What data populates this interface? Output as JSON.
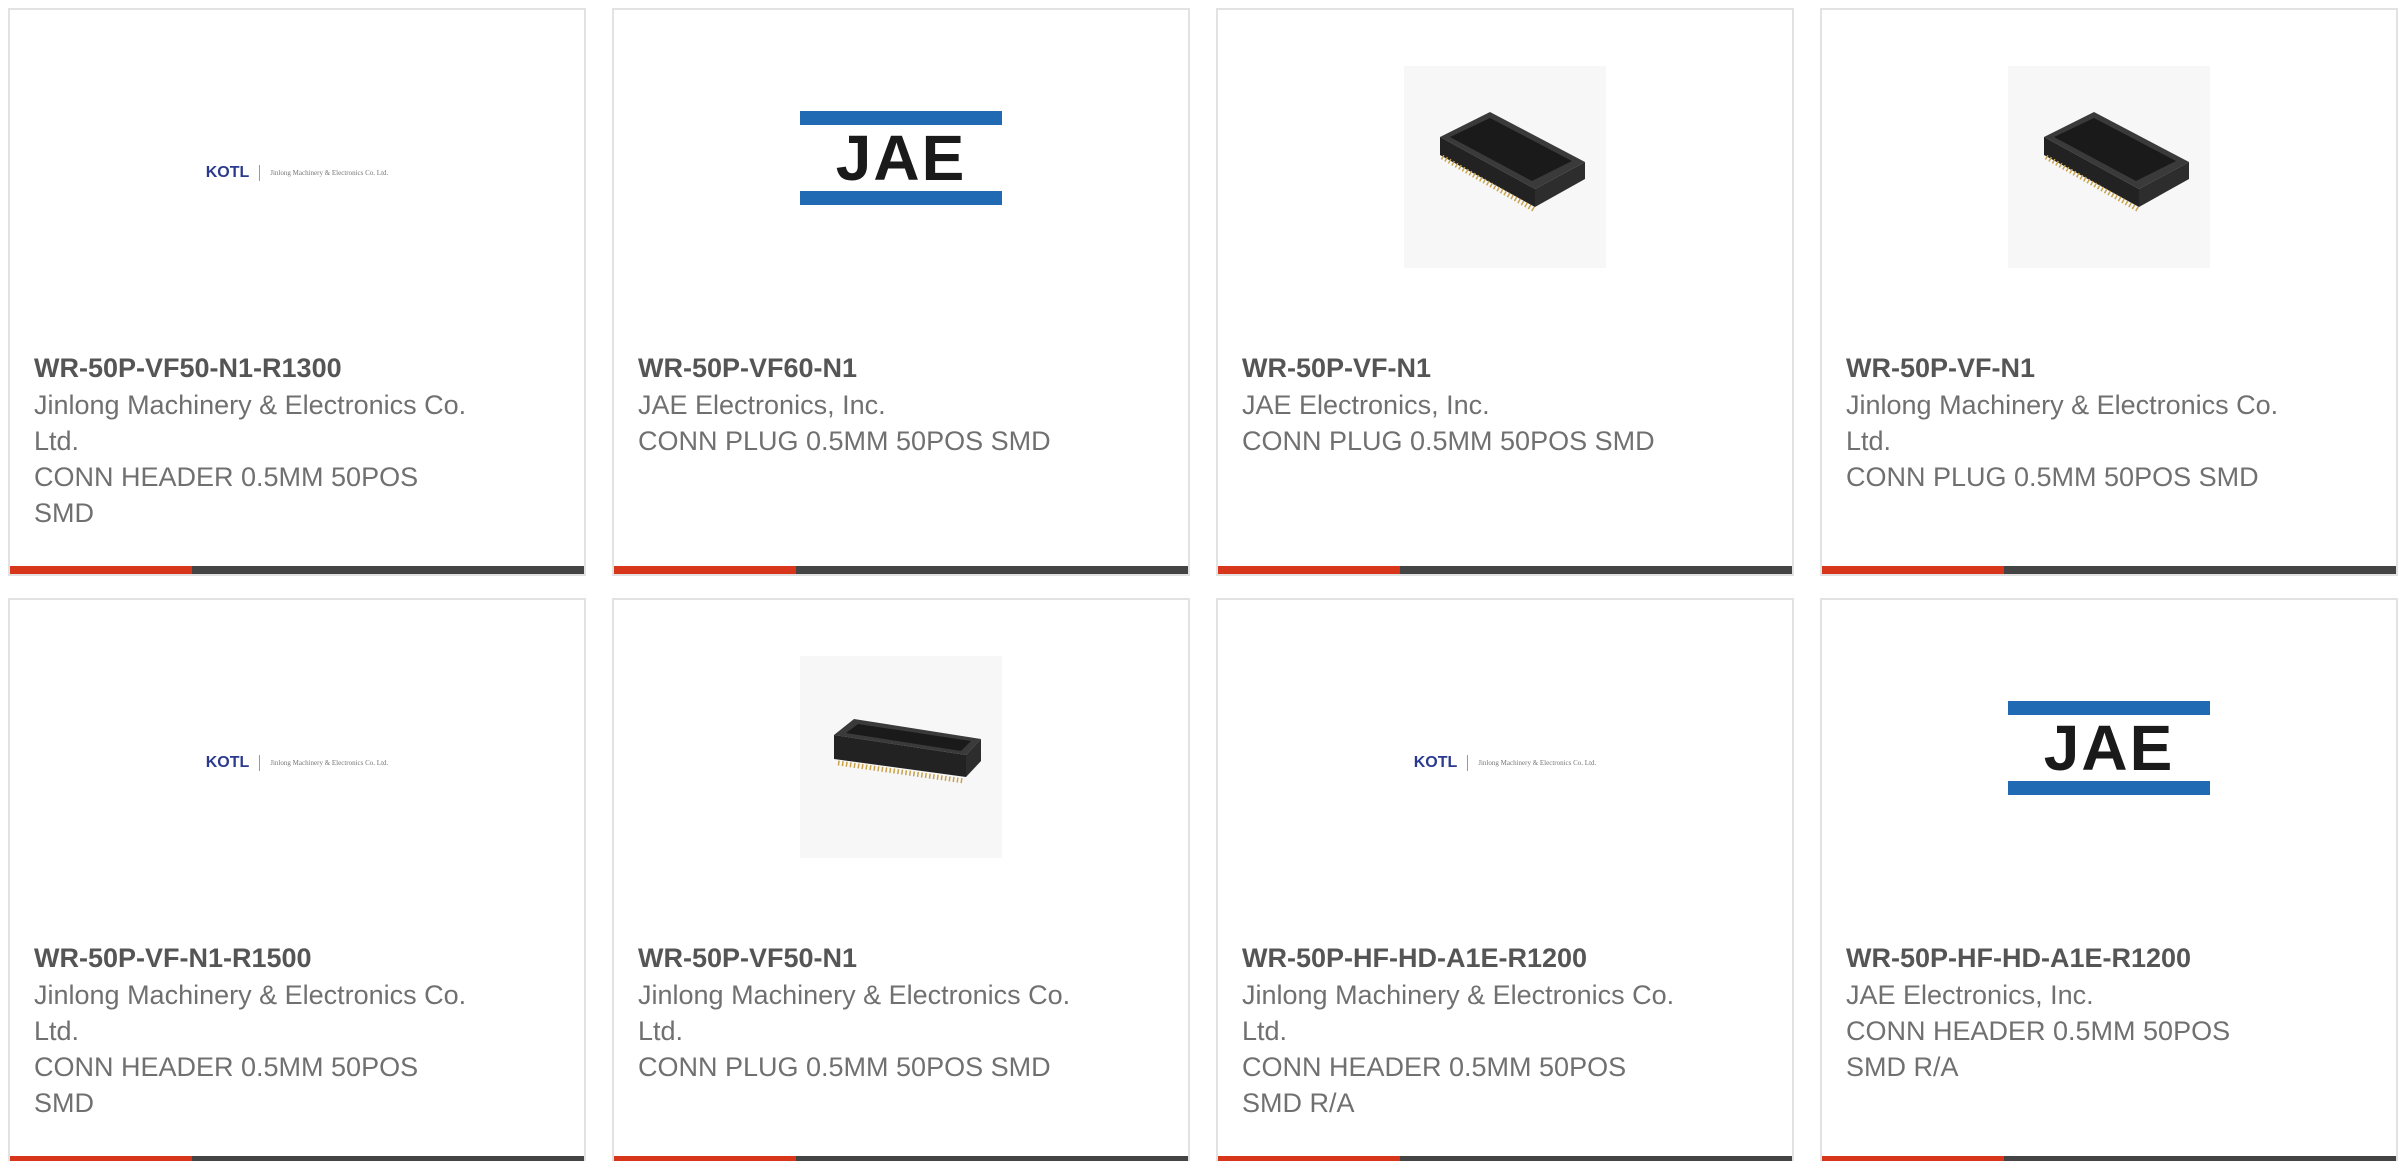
{
  "colors": {
    "accent": "#d8361a",
    "bar": "#444444",
    "jae_blue": "#1f6ab2",
    "kotl_blue": "#2b3a8f"
  },
  "cards": [
    {
      "logo": "kotl",
      "logo_text": "KOTL",
      "logo_subtext": "Jinlong Machinery & Electronics Co. Ltd.",
      "part_number": "WR-50P-VF50-N1-R1300",
      "manufacturer": "Jinlong Machinery & Electronics Co. Ltd.",
      "description": "CONN HEADER 0.5MM 50POS SMD"
    },
    {
      "logo": "jae",
      "logo_text": "JAE",
      "part_number": "WR-50P-VF60-N1",
      "manufacturer": "JAE Electronics, Inc.",
      "description": "CONN PLUG 0.5MM 50POS SMD"
    },
    {
      "logo": "connector-photo",
      "part_number": "WR-50P-VF-N1",
      "manufacturer": "JAE Electronics, Inc.",
      "description": "CONN PLUG 0.5MM 50POS SMD"
    },
    {
      "logo": "connector-photo",
      "part_number": "WR-50P-VF-N1",
      "manufacturer": "Jinlong Machinery & Electronics Co. Ltd.",
      "description": "CONN PLUG 0.5MM 50POS SMD"
    },
    {
      "logo": "kotl",
      "logo_text": "KOTL",
      "logo_subtext": "Jinlong Machinery & Electronics Co. Ltd.",
      "part_number": "WR-50P-VF-N1-R1500",
      "manufacturer": "Jinlong Machinery & Electronics Co. Ltd.",
      "description": "CONN HEADER 0.5MM 50POS SMD"
    },
    {
      "logo": "connector-photo",
      "part_number": "WR-50P-VF50-N1",
      "manufacturer": "Jinlong Machinery & Electronics Co. Ltd.",
      "description": "CONN PLUG 0.5MM 50POS SMD"
    },
    {
      "logo": "kotl",
      "logo_text": "KOTL",
      "logo_subtext": "Jinlong Machinery & Electronics Co. Ltd.",
      "part_number": "WR-50P-HF-HD-A1E-R1200",
      "manufacturer": "Jinlong Machinery & Electronics Co. Ltd.",
      "description": "CONN HEADER 0.5MM 50POS SMD R/A"
    },
    {
      "logo": "jae",
      "logo_text": "JAE",
      "part_number": "WR-50P-HF-HD-A1E-R1200",
      "manufacturer": "JAE Electronics, Inc.",
      "description": "CONN HEADER 0.5MM 50POS SMD R/A"
    }
  ]
}
